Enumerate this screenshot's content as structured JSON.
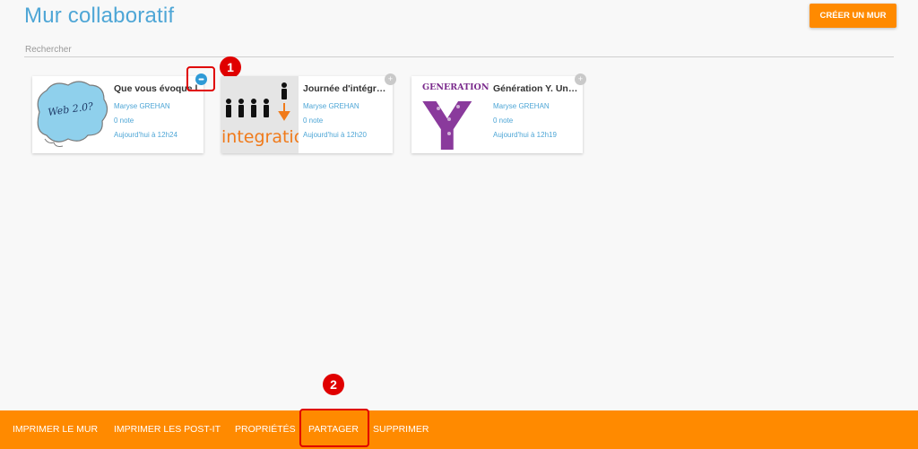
{
  "header": {
    "title": "Mur collaboratif",
    "create_button": "CRÉER UN MUR"
  },
  "search": {
    "placeholder": "Rechercher"
  },
  "cards": [
    {
      "title": "Que vous évoque l",
      "author": "Maryse GREHAN",
      "notes": "0 note",
      "time": "Aujourd'hui à 12h24",
      "thumb_text": "Web 2.0?"
    },
    {
      "title": "Journée d'intégrati…",
      "author": "Maryse GREHAN",
      "notes": "0 note",
      "time": "Aujourd'hui à 12h20",
      "thumb_text": "integration"
    },
    {
      "title": "Génération Y. Une …",
      "author": "Maryse GREHAN",
      "notes": "0 note",
      "time": "Aujourd'hui à 12h19",
      "thumb_text": "GENERATION",
      "thumb_letter": "Y"
    }
  ],
  "markers": [
    "1",
    "2"
  ],
  "bottom_bar": {
    "items": [
      "IMPRIMER LE MUR",
      "IMPRIMER LES POST-IT",
      "PROPRIÉTÉS",
      "PARTAGER",
      "SUPPRIMER"
    ]
  },
  "colors": {
    "accent": "#ff8a00",
    "link": "#4ea6d6",
    "marker": "#e00000"
  },
  "icons": {
    "card_action": "chat-bubble-icon",
    "card_menu": "plus-icon"
  }
}
